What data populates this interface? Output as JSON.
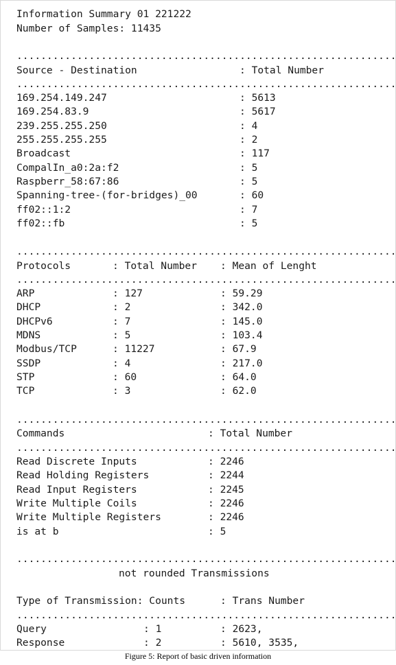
{
  "header": {
    "title": "Information Summary 01 221222",
    "samples": "Number of Samples: 11435"
  },
  "separator": "........................................................................",
  "sections": {
    "source_dest": {
      "col1": "Source - Destination",
      "col2": ": Total Number",
      "rows": [
        [
          "169.254.149.247",
          ": 5613"
        ],
        [
          "169.254.83.9",
          ": 5617"
        ],
        [
          "239.255.255.250",
          ": 4"
        ],
        [
          "255.255.255.255",
          ": 2"
        ],
        [
          "Broadcast",
          ": 117"
        ],
        [
          "CompalIn_a0:2a:f2",
          ": 5"
        ],
        [
          "Raspberr_58:67:86",
          ": 5"
        ],
        [
          "Spanning-tree-(for-bridges)_00",
          ": 60"
        ],
        [
          "ff02::1:2",
          ": 7"
        ],
        [
          "ff02::fb",
          ": 5"
        ]
      ]
    },
    "protocols": {
      "col1": "Protocols",
      "col2": ": Total Number",
      "col3": ": Mean of Lenght",
      "rows": [
        [
          "ARP",
          ": 127",
          ": 59.29"
        ],
        [
          "DHCP",
          ": 2",
          ": 342.0"
        ],
        [
          "DHCPv6",
          ": 7",
          ": 145.0"
        ],
        [
          "MDNS",
          ": 5",
          ": 103.4"
        ],
        [
          "Modbus/TCP",
          ": 11227",
          ": 67.9"
        ],
        [
          "SSDP",
          ": 4",
          ": 217.0"
        ],
        [
          "STP",
          ": 60",
          ": 64.0"
        ],
        [
          "TCP",
          ": 3",
          ": 62.0"
        ]
      ]
    },
    "commands": {
      "col1": "Commands",
      "col2": ": Total Number",
      "rows": [
        [
          "Read Discrete Inputs",
          ": 2246"
        ],
        [
          "Read Holding Registers",
          ": 2244"
        ],
        [
          "Read Input Registers",
          ": 2245"
        ],
        [
          "Write Multiple Coils",
          ": 2246"
        ],
        [
          "Write Multiple Registers",
          ": 2246"
        ],
        [
          "is at b",
          ": 5"
        ]
      ]
    },
    "transmissions": {
      "subtitle": "not rounded Transmissions",
      "col1": "Type of Transmission: Counts",
      "col2": ": Trans Number",
      "rows": [
        [
          "Query",
          ": 1",
          ": 2623,"
        ],
        [
          "Response",
          ": 2",
          ": 5610, 3535,"
        ]
      ]
    }
  },
  "caption": "Figure 5: Report of basic driven information"
}
